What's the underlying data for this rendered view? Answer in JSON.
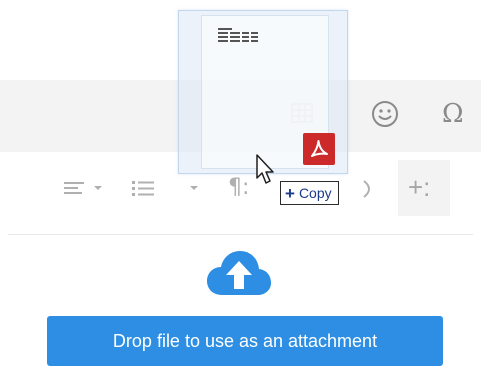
{
  "toolbar": {
    "icons": [
      "smiley-icon",
      "omega-icon",
      "table-icon",
      "align-icon",
      "list-icon",
      "paragraph-icon",
      "insert-icon"
    ],
    "omega_glyph": "Ω",
    "paragraph_glyph": "¶:",
    "plus_glyph": "+:"
  },
  "drag_preview": {
    "badge_icon": "pdf-icon",
    "tooltip": {
      "plus": "+",
      "label": "Copy"
    }
  },
  "dropzone": {
    "icon": "cloud-upload-icon",
    "message": "Drop file to use as an attachment"
  },
  "colors": {
    "accent": "#2d8ee3",
    "pdf_red": "#cc2a2a",
    "toolbar_bg": "#f3f3f3"
  }
}
